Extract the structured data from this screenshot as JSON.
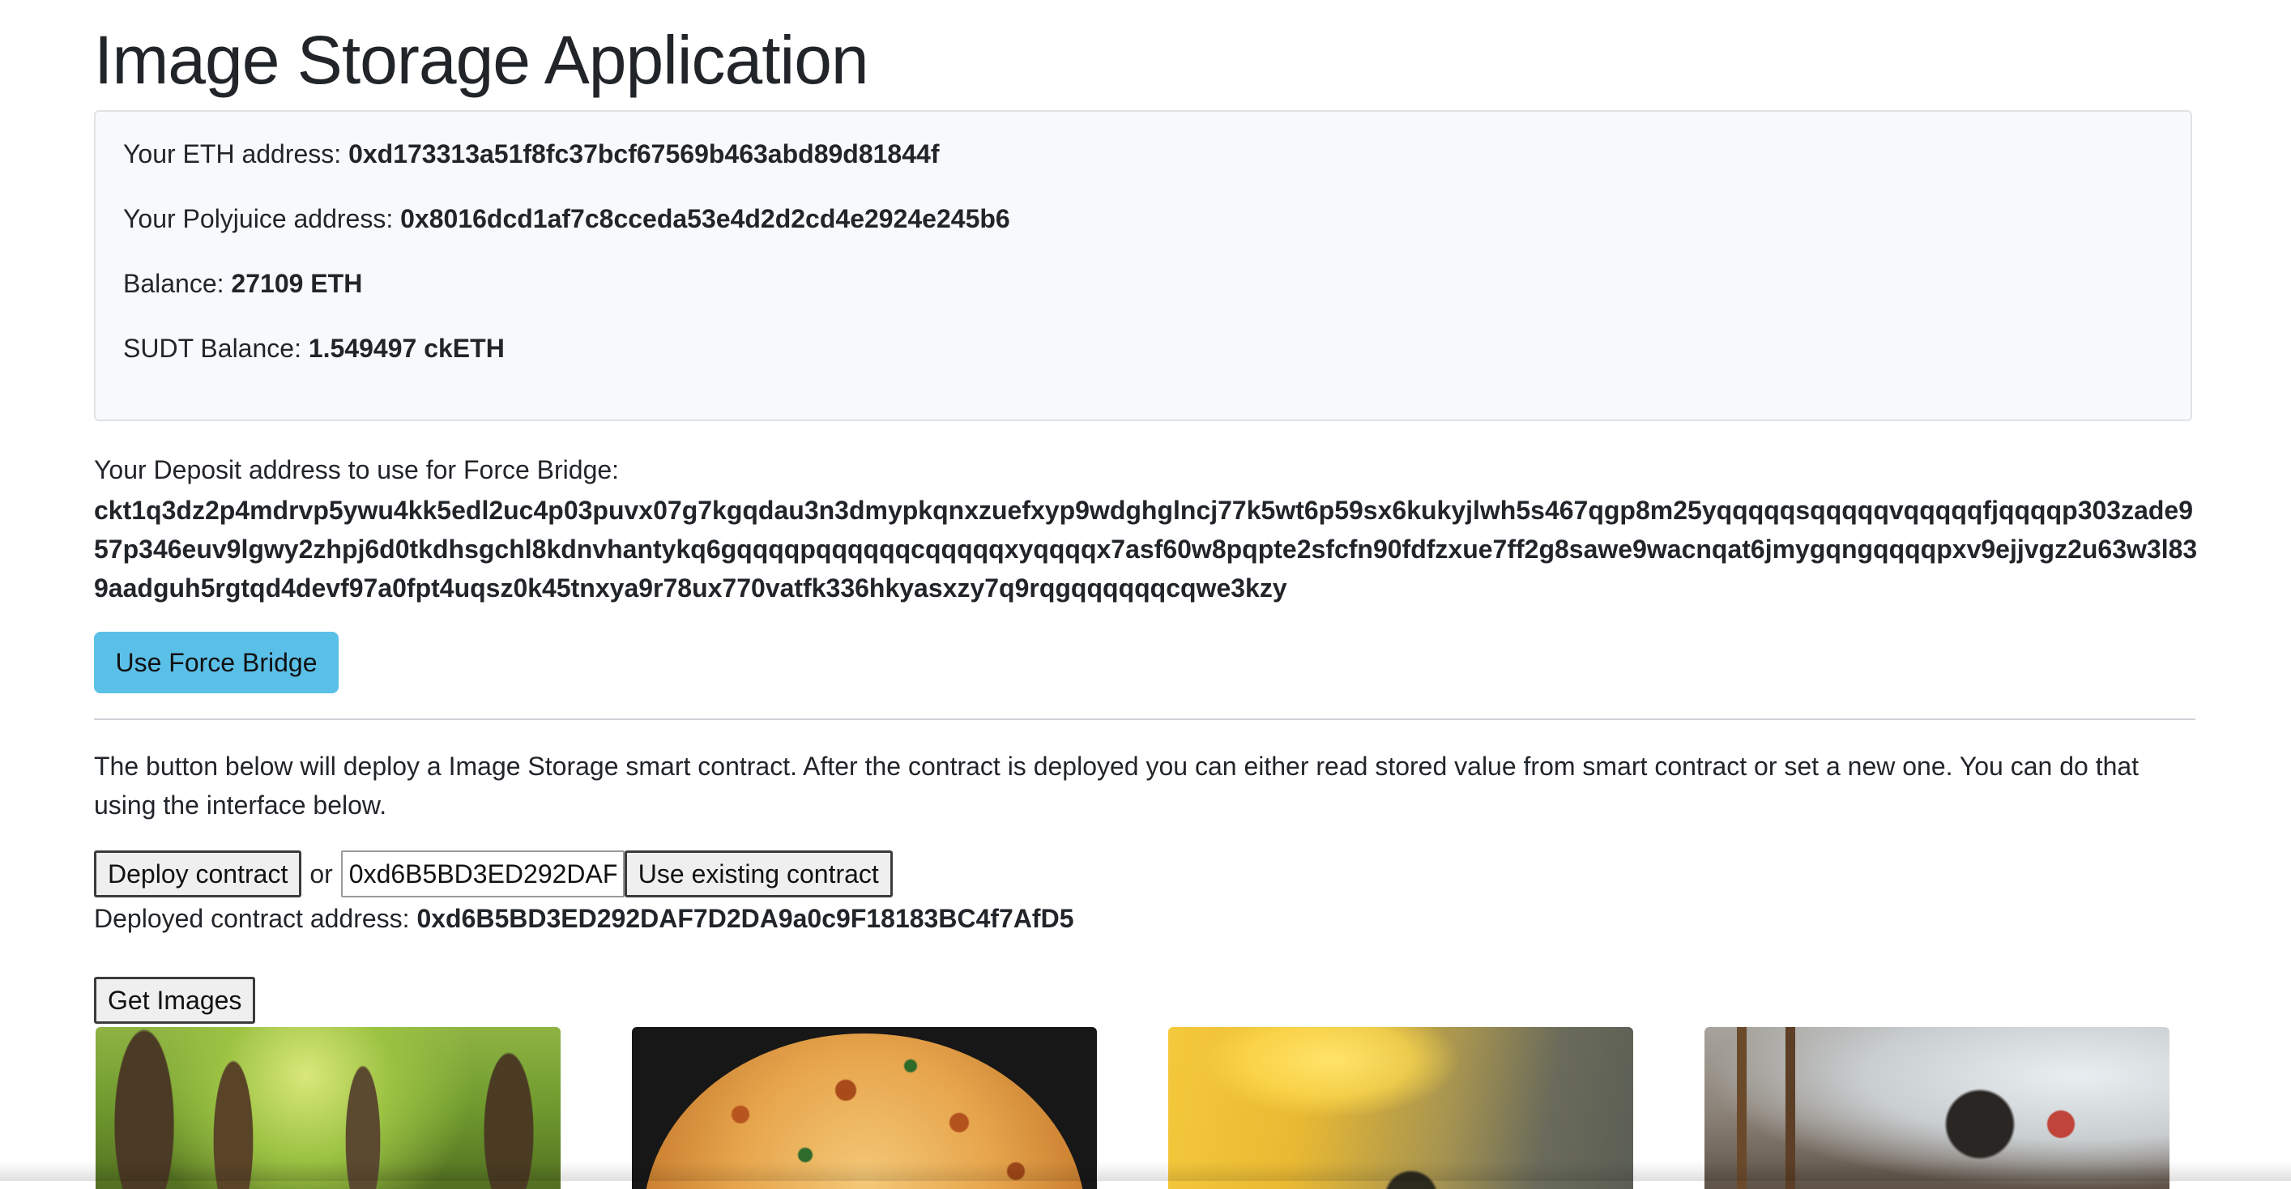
{
  "page": {
    "title": "Image Storage Application"
  },
  "info": {
    "eth_label": "Your ETH address:",
    "eth_value": "0xd173313a51f8fc37bcf67569b463abd89d81844f",
    "polyjuice_label": "Your Polyjuice address:",
    "polyjuice_value": "0x8016dcd1af7c8cceda53e4d2d2cd4e2924e245b6",
    "balance_label": "Balance:",
    "balance_value": "27109 ETH",
    "sudt_label": "SUDT Balance:",
    "sudt_value": "1.549497 ckETH"
  },
  "deposit": {
    "label": "Your Deposit address to use for Force Bridge:",
    "address": "ckt1q3dz2p4mdrvp5ywu4kk5edl2uc4p03puvx07g7kgqdau3n3dmypkqnxzuefxyp9wdghglncj77k5wt6p59sx6kukyjlwh5s467qgp8m25yqqqqqsqqqqqvqqqqqfjqqqqp303zade957p346euv9lgwy2zhpj6d0tkdhsgchl8kdnvhantykq6gqqqqpqqqqqqcqqqqqxyqqqqx7asf60w8pqpte2sfcfn90fdfzxue7ff2g8sawe9wacnqat6jmygqngqqqqpxv9ejjvgz2u63w3l839aadguh5rgtqd4devf97a0fpt4uqsz0k45tnxya9r78ux770vatfk336hkyasxzy7q9rqgqqqqqqcqwe3kzy",
    "button": "Use Force Bridge"
  },
  "contract": {
    "description": "The button below will deploy a Image Storage smart contract. After the contract is deployed you can either read stored value from smart contract or set a new one. You can do that using the interface below.",
    "deploy_button": "Deploy contract",
    "or_text": "or",
    "address_input_value": "0xd6B5BD3ED292DAF",
    "use_existing_button": "Use existing contract",
    "deployed_label": "Deployed contract address:",
    "deployed_value": "0xd6B5BD3ED292DAF7D2DA9a0c9F18183BC4f7AfD5"
  },
  "gallery": {
    "get_button": "Get Images"
  }
}
